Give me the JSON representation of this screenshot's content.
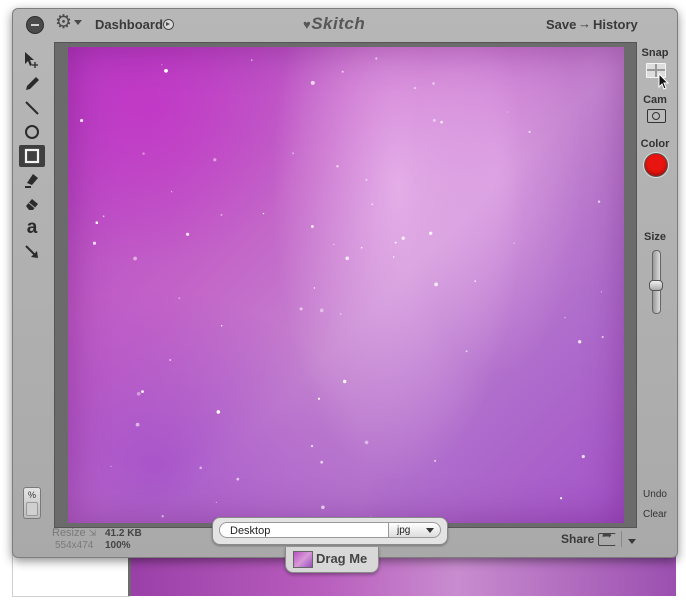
{
  "titlebar": {
    "dashboard_label": "Dashboard",
    "app_logo_text": "Skitch",
    "save_label": "Save",
    "save_arrow": "→",
    "history_label": "History"
  },
  "tools": [
    {
      "name": "select-tool",
      "icon": "arrow-move-icon"
    },
    {
      "name": "pen-tool",
      "icon": "pencil-icon"
    },
    {
      "name": "line-tool",
      "icon": "line-icon"
    },
    {
      "name": "ellipse-tool",
      "icon": "circle-icon"
    },
    {
      "name": "rectangle-tool",
      "icon": "rectangle-icon",
      "selected": true
    },
    {
      "name": "highlighter-tool",
      "icon": "highlighter-icon"
    },
    {
      "name": "eraser-tool",
      "icon": "eraser-icon"
    },
    {
      "name": "text-tool",
      "icon": "text-a-icon",
      "glyph": "a"
    },
    {
      "name": "arrow-tool",
      "icon": "arrow-icon"
    }
  ],
  "zoom_toggle_label": "%",
  "right_panel": {
    "snap_label": "Snap",
    "cam_label": "Cam",
    "color_label": "Color",
    "color_value": "#e8140f",
    "size_label": "Size",
    "size_level": 0.55,
    "undo_label": "Undo",
    "clear_label": "Clear"
  },
  "bottom_bar": {
    "resize_label": "Resize",
    "dimensions": "554x474",
    "file_size": "41.2 KB",
    "zoom": "100%",
    "destination_value": "Desktop",
    "format_value": "jpg",
    "drag_label": "Drag Me",
    "share_label": "Share"
  },
  "colors": {
    "window_bg": "#b0b0b0",
    "accent_red": "#e8140f",
    "canvas_purple": "#b84fc0"
  }
}
